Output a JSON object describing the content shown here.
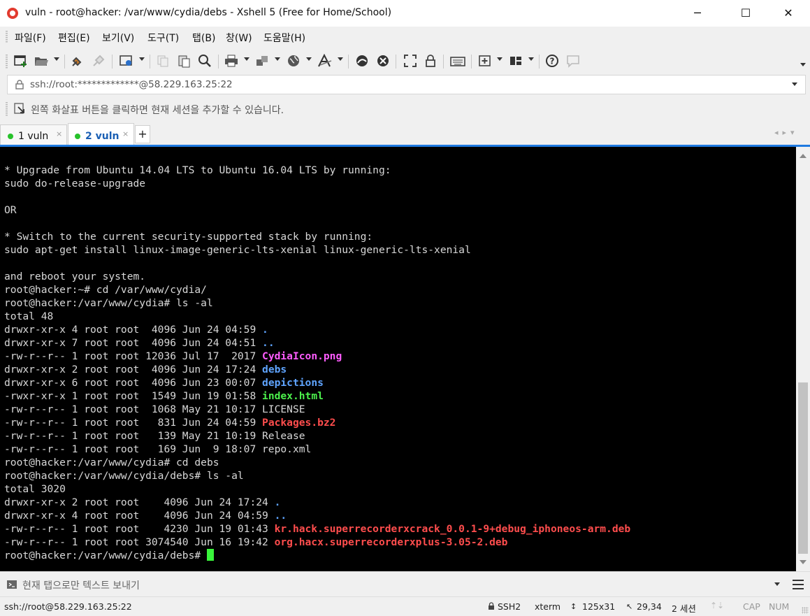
{
  "window": {
    "title": "vuln - root@hacker: /var/www/cydia/debs - Xshell 5 (Free for Home/School)",
    "minimize": "─",
    "maximize": "☐",
    "close": "✕"
  },
  "menu": [
    "파일(F)",
    "편집(E)",
    "보기(V)",
    "도구(T)",
    "탭(B)",
    "창(W)",
    "도움말(H)"
  ],
  "address": {
    "value": "ssh://root:*************@58.229.163.25:22"
  },
  "hint": "왼쪽 화살표 버튼을 클릭하면 현재 세션을 추가할 수 있습니다.",
  "tabs": [
    {
      "label": "1 vuln",
      "active": false
    },
    {
      "label": "2 vuln",
      "active": true
    }
  ],
  "terminal": {
    "lines": [
      [
        {
          "t": "* Upgrade from Ubuntu 14.04 LTS to Ubuntu 16.04 LTS by running:"
        }
      ],
      [
        {
          "t": "sudo do-release-upgrade"
        }
      ],
      [
        {
          "t": ""
        }
      ],
      [
        {
          "t": "OR"
        }
      ],
      [
        {
          "t": ""
        }
      ],
      [
        {
          "t": "* Switch to the current security-supported stack by running:"
        }
      ],
      [
        {
          "t": "sudo apt-get install linux-image-generic-lts-xenial linux-generic-lts-xenial"
        }
      ],
      [
        {
          "t": ""
        }
      ],
      [
        {
          "t": "and reboot your system."
        }
      ],
      [
        {
          "t": "root@hacker:~# cd /var/www/cydia/"
        }
      ],
      [
        {
          "t": "root@hacker:/var/www/cydia# ls -al"
        }
      ],
      [
        {
          "t": "total 48"
        }
      ],
      [
        {
          "t": "drwxr-xr-x 4 root root  4096 Jun 24 04:59 "
        },
        {
          "t": ".",
          "c": "blue"
        }
      ],
      [
        {
          "t": "drwxr-xr-x 7 root root  4096 Jun 24 04:51 "
        },
        {
          "t": "..",
          "c": "blue"
        }
      ],
      [
        {
          "t": "-rw-r--r-- 1 root root 12036 Jul 17  2017 "
        },
        {
          "t": "CydiaIcon.png",
          "c": "magenta"
        }
      ],
      [
        {
          "t": "drwxr-xr-x 2 root root  4096 Jun 24 17:24 "
        },
        {
          "t": "debs",
          "c": "blue"
        }
      ],
      [
        {
          "t": "drwxr-xr-x 6 root root  4096 Jun 23 00:07 "
        },
        {
          "t": "depictions",
          "c": "blue"
        }
      ],
      [
        {
          "t": "-rwxr-xr-x 1 root root  1549 Jun 19 01:58 "
        },
        {
          "t": "index.html",
          "c": "green"
        }
      ],
      [
        {
          "t": "-rw-r--r-- 1 root root  1068 May 21 10:17 LICENSE"
        }
      ],
      [
        {
          "t": "-rw-r--r-- 1 root root   831 Jun 24 04:59 "
        },
        {
          "t": "Packages.bz2",
          "c": "red"
        }
      ],
      [
        {
          "t": "-rw-r--r-- 1 root root   139 May 21 10:19 Release"
        }
      ],
      [
        {
          "t": "-rw-r--r-- 1 root root   169 Jun  9 18:07 repo.xml"
        }
      ],
      [
        {
          "t": "root@hacker:/var/www/cydia# cd debs"
        }
      ],
      [
        {
          "t": "root@hacker:/var/www/cydia/debs# ls -al"
        }
      ],
      [
        {
          "t": "total 3020"
        }
      ],
      [
        {
          "t": "drwxr-xr-x 2 root root    4096 Jun 24 17:24 "
        },
        {
          "t": ".",
          "c": "blue"
        }
      ],
      [
        {
          "t": "drwxr-xr-x 4 root root    4096 Jun 24 04:59 "
        },
        {
          "t": "..",
          "c": "blue"
        }
      ],
      [
        {
          "t": "-rw-r--r-- 1 root root    4230 Jun 19 01:43 "
        },
        {
          "t": "kr.hack.superrecorderxcrack_0.0.1-9+debug_iphoneos-arm.deb",
          "c": "red"
        }
      ],
      [
        {
          "t": "-rw-r--r-- 1 root root 3074540 Jun 16 19:42 "
        },
        {
          "t": "org.hacx.superrecorderxplus-3.05-2.deb",
          "c": "red"
        }
      ],
      [
        {
          "t": "root@hacker:/var/www/cydia/debs# "
        },
        {
          "cursor": true
        }
      ]
    ]
  },
  "compose": {
    "placeholder": "현재 탭으로만 텍스트 보내기"
  },
  "status": {
    "connection": "ssh://root@58.229.163.25:22",
    "protocol": "SSH2",
    "terminal_type": "xterm",
    "size": "125x31",
    "cursor_pos": "29,34",
    "sessions": "2 세션",
    "cap": "CAP",
    "num": "NUM"
  },
  "colors": {
    "accent": "#1f7ae0",
    "tab_active_dot": "#27c22b",
    "term_bg": "#000000",
    "dir_blue": "#5fa4ff",
    "img_magenta": "#ff5cff",
    "exec_green": "#4cf04c",
    "archive_red": "#ff4d4d"
  },
  "icons": [
    "new-session-icon",
    "open-folder-icon",
    "reconnect-icon",
    "disconnect-icon",
    "properties-icon",
    "copy-icon",
    "paste-icon",
    "find-icon",
    "print-icon",
    "transfer-icon",
    "globe-icon",
    "font-icon",
    "xftp-icon",
    "xmanager-icon",
    "fullscreen-icon",
    "lock-icon",
    "keyboard-icon",
    "new-tab-icon",
    "layout-icon",
    "help-icon",
    "chat-icon"
  ]
}
